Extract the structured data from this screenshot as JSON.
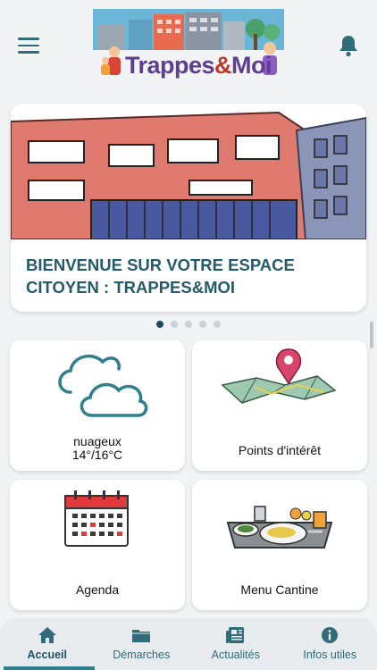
{
  "app": {
    "logo_text_main": "Trappes",
    "logo_text_amp": "&",
    "logo_text_end": "Moi"
  },
  "hero": {
    "title": "BIENVENUE SUR VOTRE ESPACE CITOYEN : TRAPPES&MOI",
    "slides_count": 5,
    "active_slide": 1
  },
  "weather": {
    "condition": "nuageux",
    "temperature": "14°/16°C"
  },
  "tiles": [
    {
      "label": "Points d'intérêt",
      "icon": "map-pin-icon"
    },
    {
      "label": "Agenda",
      "icon": "calendar-icon"
    },
    {
      "label": "Menu Cantine",
      "icon": "meal-tray-icon"
    }
  ],
  "nav": [
    {
      "label": "Accueil",
      "icon": "home-icon",
      "active": true
    },
    {
      "label": "Démarches",
      "icon": "folder-icon",
      "active": false
    },
    {
      "label": "Actualités",
      "icon": "news-icon",
      "active": false
    },
    {
      "label": "Infos utiles",
      "icon": "info-icon",
      "active": false
    }
  ],
  "colors": {
    "primary": "#2f6b78",
    "title": "#245b6b",
    "accent_red": "#d9443a",
    "background": "#f2f3f5"
  }
}
